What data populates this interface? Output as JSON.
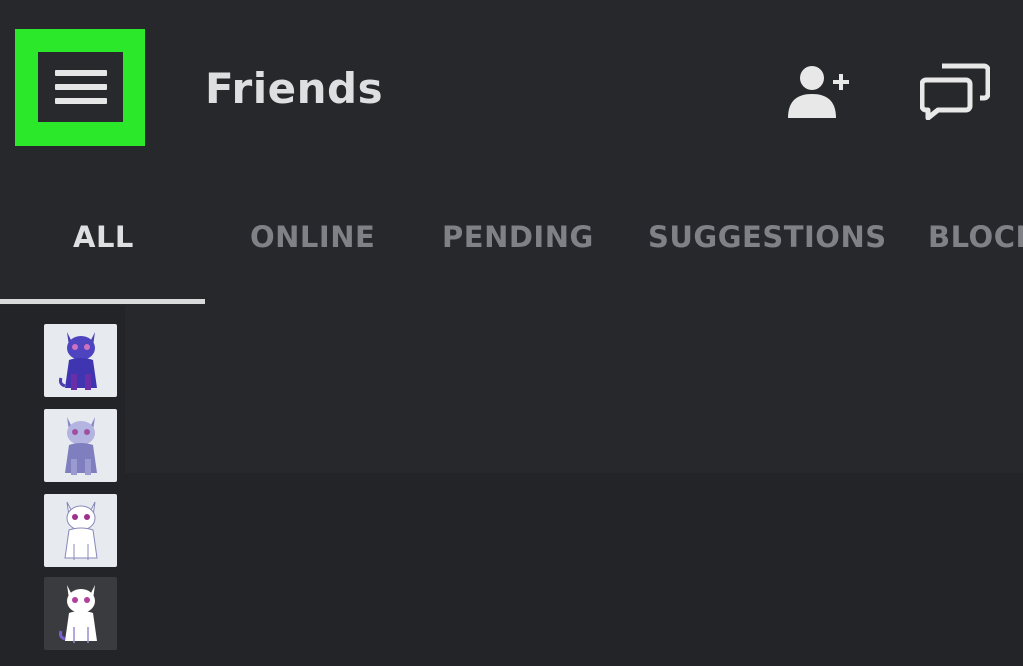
{
  "header": {
    "title": "Friends",
    "menu_icon": "hamburger-menu-icon",
    "highlight_color": "#2be82b",
    "actions": [
      {
        "icon": "add-friend-icon"
      },
      {
        "icon": "group-dm-icon"
      }
    ]
  },
  "tabs": [
    {
      "label": "ALL",
      "active": true
    },
    {
      "label": "ONLINE",
      "active": false
    },
    {
      "label": "PENDING",
      "active": false
    },
    {
      "label": "SUGGESTIONS",
      "active": false
    },
    {
      "label": "BLOCK",
      "active": false
    }
  ],
  "friends": [
    {
      "avatar": "cat-avatar-purple"
    },
    {
      "avatar": "cat-avatar-lavender"
    },
    {
      "avatar": "cat-avatar-white"
    },
    {
      "avatar": "cat-avatar-white-dark"
    }
  ],
  "colors": {
    "background": "#232428",
    "header_bg": "#27282c",
    "active_tab": "#dedfe1",
    "inactive_tab": "#7f8186"
  }
}
